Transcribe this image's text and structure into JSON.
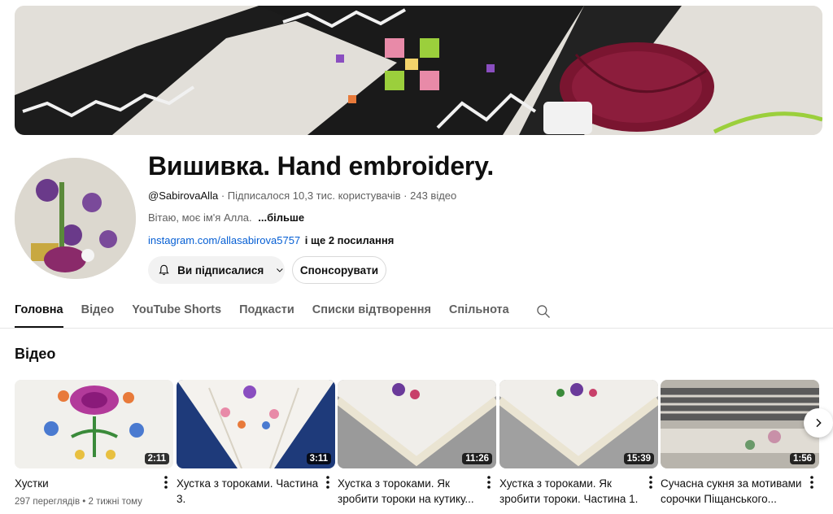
{
  "channel": {
    "title": "Вишивка. Hand embroidery.",
    "handle": "@SabirovaAlla",
    "subscribers": "Підписалося 10,3 тис. користувачів",
    "video_count": "243 відео",
    "sep": "·",
    "description": "Вітаю, моє ім'я Алла.",
    "more_label": "...більше",
    "link": "instagram.com/allasabirova5757",
    "extra_links": "і ще 2 посилання"
  },
  "buttons": {
    "subscribed_label": "Ви підписалися",
    "sponsor_label": "Спонсорувати"
  },
  "tabs": [
    {
      "label": "Головна",
      "active": true
    },
    {
      "label": "Відео"
    },
    {
      "label": "YouTube Shorts"
    },
    {
      "label": "Подкасти"
    },
    {
      "label": "Списки відтворення"
    },
    {
      "label": "Спільнота"
    }
  ],
  "section_title": "Відео",
  "videos": [
    {
      "title": "Хустки",
      "duration": "2:11",
      "views": "297 переглядів",
      "age": "2 тижні тому"
    },
    {
      "title": "Хустка з тороками. Частина 3.",
      "duration": "3:11"
    },
    {
      "title": "Хустка з тороками. Як зробити тороки на кутику...",
      "duration": "11:26"
    },
    {
      "title": "Хустка з тороками. Як зробити тороки. Частина 1.",
      "duration": "15:39"
    },
    {
      "title": "Сучасна сукня за мотивами сорочки Піщанського...",
      "duration": "1:56"
    }
  ],
  "colors": {
    "link": "#065fd4",
    "banner_black": "#1a1a1a",
    "thread_burgundy": "#7a1530"
  }
}
